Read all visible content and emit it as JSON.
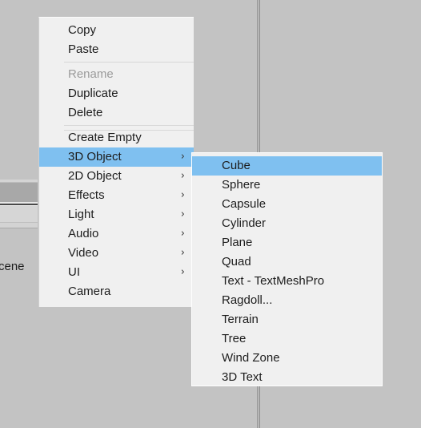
{
  "app": {
    "background_color": "#c3c3c3",
    "menu_background": "#f0f0f0",
    "highlight_color": "#7fc0f0",
    "text_color": "#1d1d1d",
    "disabled_text_color": "#9b9b9b"
  },
  "background": {
    "panel_label": "cene",
    "divider_name": "vertical-splitter"
  },
  "context_menu": {
    "items": [
      {
        "label": "Copy",
        "type": "item",
        "has_submenu": false,
        "enabled": true,
        "highlighted": false
      },
      {
        "label": "Paste",
        "type": "item",
        "has_submenu": false,
        "enabled": true,
        "highlighted": false
      },
      {
        "label": "",
        "type": "separator",
        "has_submenu": false,
        "enabled": true,
        "highlighted": false
      },
      {
        "label": "Rename",
        "type": "item",
        "has_submenu": false,
        "enabled": false,
        "highlighted": false
      },
      {
        "label": "Duplicate",
        "type": "item",
        "has_submenu": false,
        "enabled": true,
        "highlighted": false
      },
      {
        "label": "Delete",
        "type": "item",
        "has_submenu": false,
        "enabled": true,
        "highlighted": false
      },
      {
        "label": "",
        "type": "separator-double",
        "has_submenu": false,
        "enabled": true,
        "highlighted": false
      },
      {
        "label": "Create Empty",
        "type": "item",
        "has_submenu": false,
        "enabled": true,
        "highlighted": false
      },
      {
        "label": "3D Object",
        "type": "item",
        "has_submenu": true,
        "enabled": true,
        "highlighted": true
      },
      {
        "label": "2D Object",
        "type": "item",
        "has_submenu": true,
        "enabled": true,
        "highlighted": false
      },
      {
        "label": "Effects",
        "type": "item",
        "has_submenu": true,
        "enabled": true,
        "highlighted": false
      },
      {
        "label": "Light",
        "type": "item",
        "has_submenu": true,
        "enabled": true,
        "highlighted": false
      },
      {
        "label": "Audio",
        "type": "item",
        "has_submenu": true,
        "enabled": true,
        "highlighted": false
      },
      {
        "label": "Video",
        "type": "item",
        "has_submenu": true,
        "enabled": true,
        "highlighted": false
      },
      {
        "label": "UI",
        "type": "item",
        "has_submenu": true,
        "enabled": true,
        "highlighted": false
      },
      {
        "label": "Camera",
        "type": "item",
        "has_submenu": false,
        "enabled": true,
        "highlighted": false
      }
    ],
    "submenu_arrow_glyph": "›"
  },
  "submenu": {
    "parent": "3D Object",
    "items": [
      {
        "label": "Cube",
        "highlighted": true
      },
      {
        "label": "Sphere",
        "highlighted": false
      },
      {
        "label": "Capsule",
        "highlighted": false
      },
      {
        "label": "Cylinder",
        "highlighted": false
      },
      {
        "label": "Plane",
        "highlighted": false
      },
      {
        "label": "Quad",
        "highlighted": false
      },
      {
        "label": "Text - TextMeshPro",
        "highlighted": false
      },
      {
        "label": "Ragdoll...",
        "highlighted": false
      },
      {
        "label": "Terrain",
        "highlighted": false
      },
      {
        "label": "Tree",
        "highlighted": false
      },
      {
        "label": "Wind Zone",
        "highlighted": false
      },
      {
        "label": "3D Text",
        "highlighted": false
      }
    ]
  }
}
